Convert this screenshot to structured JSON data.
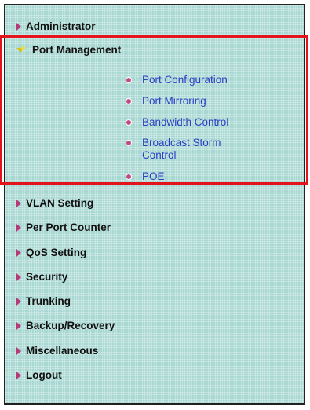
{
  "menu": {
    "administrator": "Administrator",
    "port_management": "Port Management",
    "vlan_setting": "VLAN Setting",
    "per_port_counter": "Per Port Counter",
    "qos_setting": "QoS Setting",
    "security": "Security",
    "trunking": "Trunking",
    "backup_recovery": "Backup/Recovery",
    "miscellaneous": "Miscellaneous",
    "logout": "Logout"
  },
  "submenu": {
    "port_configuration": "Port Configuration",
    "port_mirroring": "Port Mirroring",
    "bandwidth_control": "Bandwidth Control",
    "broadcast_storm_control": "Broadcast Storm Control",
    "poe": "POE"
  },
  "colors": {
    "panel_bg": "#a9d8d3",
    "menu_arrow": "#b53a78",
    "active_arrow": "#d6c21f",
    "submenu_link": "#2a3fc2",
    "highlight_box": "#e3141b"
  },
  "icons": {
    "menu_arrow": "arrow-right-icon",
    "active_arrow": "arrow-down-icon",
    "submenu_bullet": "bullet-icon"
  }
}
